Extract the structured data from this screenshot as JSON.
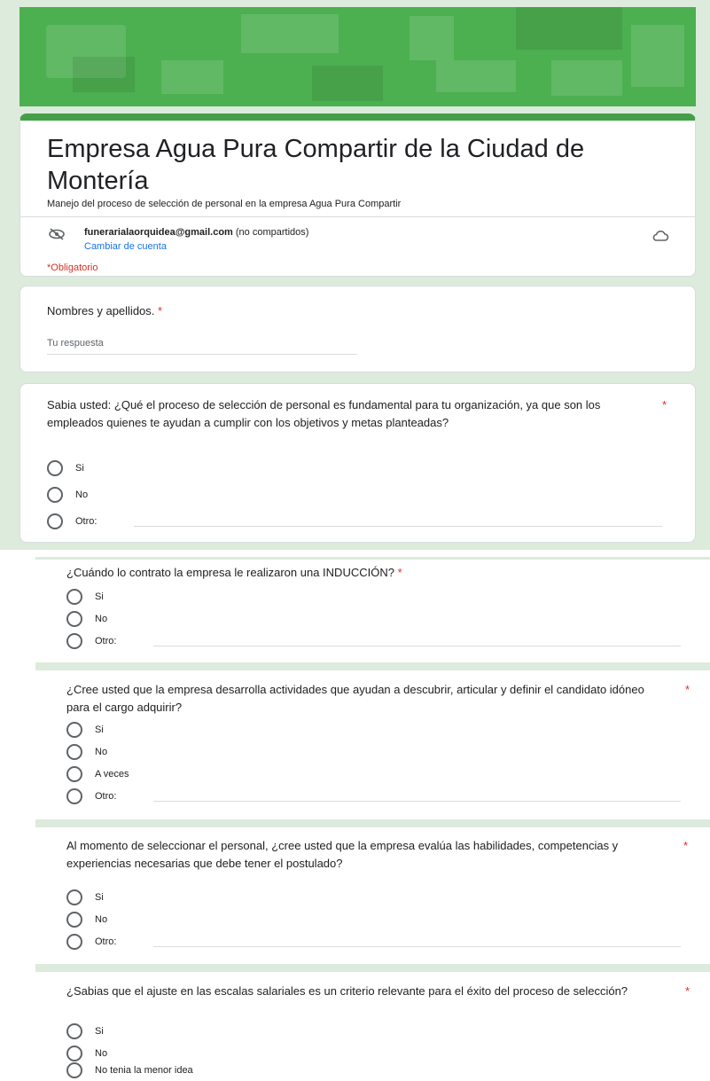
{
  "form": {
    "title": "Empresa Agua Pura Compartir de la Ciudad de Montería",
    "description": "Manejo del proceso de selección de personal en la empresa Agua Pura Compartir",
    "account_email": "funerarialaorquidea@gmail.com",
    "account_note": "(no compartidos)",
    "switch_account": "Cambiar de cuenta",
    "required_note": "*Obligatorio"
  },
  "colors": {
    "theme": "#4caf50",
    "background": "#dcebdc",
    "required": "#d93025",
    "link": "#1a73e8"
  },
  "q1": {
    "text": "Nombres y apellidos.",
    "star": "*",
    "placeholder": "Tu respuesta"
  },
  "q2": {
    "text": "Sabia usted: ¿Qué el proceso de selección de personal es fundamental para tu organización, ya que son los empleados quienes te ayudan a cumplir con los objetivos y metas planteadas?",
    "star": "*",
    "options": [
      "Si",
      "No",
      "Otro:"
    ]
  },
  "q3": {
    "text": "¿Cuándo lo contrato la empresa le realizaron una INDUCCIÓN?",
    "star": "*",
    "options": [
      "Si",
      "No",
      "Otro:"
    ]
  },
  "q4": {
    "text": "¿Cree usted que la empresa desarrolla actividades que ayudan a descubrir, articular y definir el candidato idóneo para el cargo adquirir?",
    "star": "*",
    "options": [
      "Si",
      "No",
      "A veces",
      "Otro:"
    ]
  },
  "q5": {
    "text": "Al momento de seleccionar el personal, ¿cree usted que la empresa evalúa las habilidades, competencias y experiencias necesarias que debe tener el postulado?",
    "star": "*",
    "options": [
      "Si",
      "No",
      "Otro:"
    ]
  },
  "q6": {
    "text": "¿Sabias que el ajuste en las escalas salariales es un criterio relevante para el éxito del proceso de selección?",
    "star": "*",
    "options": [
      "Si",
      "No",
      "No tenia la menor idea"
    ]
  }
}
